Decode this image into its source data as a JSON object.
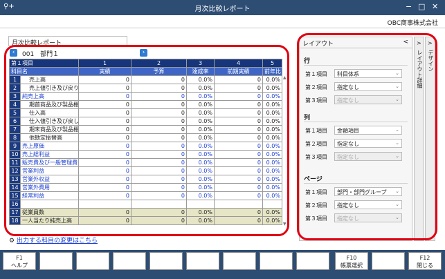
{
  "window": {
    "title": "月次比較レポート",
    "company": "OBC商事株式会社"
  },
  "report_title": "月次比較レポート",
  "nav": {
    "label": "001　部門１"
  },
  "table": {
    "group_headers": [
      "第１項目",
      "1",
      "2",
      "3",
      "4",
      "5"
    ],
    "col_headers": [
      "科目名",
      "実績",
      "予算",
      "達成率",
      "前期実績",
      "前年比"
    ],
    "rows": [
      {
        "n": "1",
        "name": "売上高",
        "indent": 1,
        "blue": false,
        "v": [
          "0",
          "0",
          "0.0%",
          "0",
          "0.0%"
        ]
      },
      {
        "n": "2",
        "name": "売上値引き及び戻り",
        "indent": 1,
        "blue": false,
        "v": [
          "0",
          "0",
          "0.0%",
          "0",
          "0.0%"
        ]
      },
      {
        "n": "3",
        "name": "純売上高",
        "indent": 0,
        "blue": true,
        "v": [
          "0",
          "0",
          "0.0%",
          "0",
          "0.0%"
        ]
      },
      {
        "n": "4",
        "name": "期首商品及び製品棚",
        "indent": 1,
        "blue": false,
        "v": [
          "0",
          "0",
          "0.0%",
          "0",
          "0.0%"
        ]
      },
      {
        "n": "5",
        "name": "仕入高",
        "indent": 1,
        "blue": false,
        "v": [
          "0",
          "0",
          "0.0%",
          "0",
          "0.0%"
        ]
      },
      {
        "n": "6",
        "name": "仕入値引き及び戻し",
        "indent": 1,
        "blue": false,
        "v": [
          "0",
          "0",
          "0.0%",
          "0",
          "0.0%"
        ]
      },
      {
        "n": "7",
        "name": "期末商品及び製品棚",
        "indent": 1,
        "blue": false,
        "v": [
          "0",
          "0",
          "0.0%",
          "0",
          "0.0%"
        ]
      },
      {
        "n": "8",
        "name": "他勘定振替高",
        "indent": 1,
        "blue": false,
        "v": [
          "0",
          "0",
          "0.0%",
          "0",
          "0.0%"
        ]
      },
      {
        "n": "9",
        "name": "売上原価",
        "indent": 0,
        "blue": true,
        "v": [
          "0",
          "0",
          "0.0%",
          "0",
          "0.0%"
        ]
      },
      {
        "n": "10",
        "name": "売上総利益",
        "indent": 0,
        "blue": true,
        "v": [
          "0",
          "0",
          "0.0%",
          "0",
          "0.0%"
        ]
      },
      {
        "n": "11",
        "name": "販売費及び一般管理費",
        "indent": 0,
        "blue": true,
        "v": [
          "0",
          "0",
          "0.0%",
          "0",
          "0.0%"
        ]
      },
      {
        "n": "12",
        "name": "営業利益",
        "indent": 0,
        "blue": true,
        "v": [
          "0",
          "0",
          "0.0%",
          "0",
          "0.0%"
        ]
      },
      {
        "n": "13",
        "name": "営業外収益",
        "indent": 0,
        "blue": true,
        "v": [
          "0",
          "0",
          "0.0%",
          "0",
          "0.0%"
        ]
      },
      {
        "n": "14",
        "name": "営業外費用",
        "indent": 0,
        "blue": true,
        "v": [
          "0",
          "0",
          "0.0%",
          "0",
          "0.0%"
        ]
      },
      {
        "n": "15",
        "name": "経常利益",
        "indent": 0,
        "blue": true,
        "v": [
          "0",
          "0",
          "0.0%",
          "0",
          "0.0%"
        ]
      },
      {
        "n": "16",
        "name": "",
        "indent": 0,
        "blue": false,
        "v": [
          "",
          "",
          "",
          "",
          ""
        ]
      },
      {
        "n": "17",
        "name": "従業員数",
        "indent": 0,
        "blue": false,
        "footer": true,
        "v": [
          "0",
          "0",
          "0.0%",
          "0",
          "0.0%"
        ]
      },
      {
        "n": "18",
        "name": "一人当たり純売上高",
        "indent": 0,
        "blue": false,
        "footer": true,
        "v": [
          "0",
          "0",
          "0.0%",
          "0",
          "0.0%"
        ]
      }
    ]
  },
  "link_text": "出力する科目の変更はこちら",
  "layout": {
    "title": "レイアウト",
    "collapse": "<",
    "sections": [
      {
        "name": "行",
        "items": [
          {
            "label": "第１項目",
            "value": "科目体系",
            "disabled": false
          },
          {
            "label": "第２項目",
            "value": "指定なし",
            "disabled": false
          },
          {
            "label": "第３項目",
            "value": "指定なし",
            "disabled": true
          }
        ]
      },
      {
        "name": "列",
        "items": [
          {
            "label": "第１項目",
            "value": "金額項目",
            "disabled": false
          },
          {
            "label": "第２項目",
            "value": "指定なし",
            "disabled": false
          },
          {
            "label": "第３項目",
            "value": "指定なし",
            "disabled": true
          }
        ]
      },
      {
        "name": "ページ",
        "items": [
          {
            "label": "第１項目",
            "value": "部門・部門グループ",
            "disabled": false
          },
          {
            "label": "第２項目",
            "value": "指定なし",
            "disabled": false
          },
          {
            "label": "第３項目",
            "value": "指定なし",
            "disabled": true
          }
        ]
      }
    ]
  },
  "side_tabs": [
    {
      "label": "レイアウト詳細",
      "arrow": ">"
    },
    {
      "label": "デザイン",
      "arrow": ">"
    }
  ],
  "fkeys": [
    {
      "key": "F1",
      "label": "ヘルプ"
    },
    {
      "key": "",
      "label": ""
    },
    {
      "key": "",
      "label": ""
    },
    {
      "key": "",
      "label": ""
    },
    {
      "key": "",
      "label": ""
    },
    {
      "key": "",
      "label": ""
    },
    {
      "key": "",
      "label": ""
    },
    {
      "key": "",
      "label": ""
    },
    {
      "key": "",
      "label": ""
    },
    {
      "key": "F10",
      "label": "帳票選択"
    },
    {
      "key": "",
      "label": ""
    },
    {
      "key": "F12",
      "label": "閉じる"
    }
  ],
  "colors": {
    "titlebar": "#2e4d73",
    "header_dark": "#16357a",
    "header_mid": "#3f66c6",
    "highlight": "#e00012",
    "link": "#1a3fd0"
  }
}
